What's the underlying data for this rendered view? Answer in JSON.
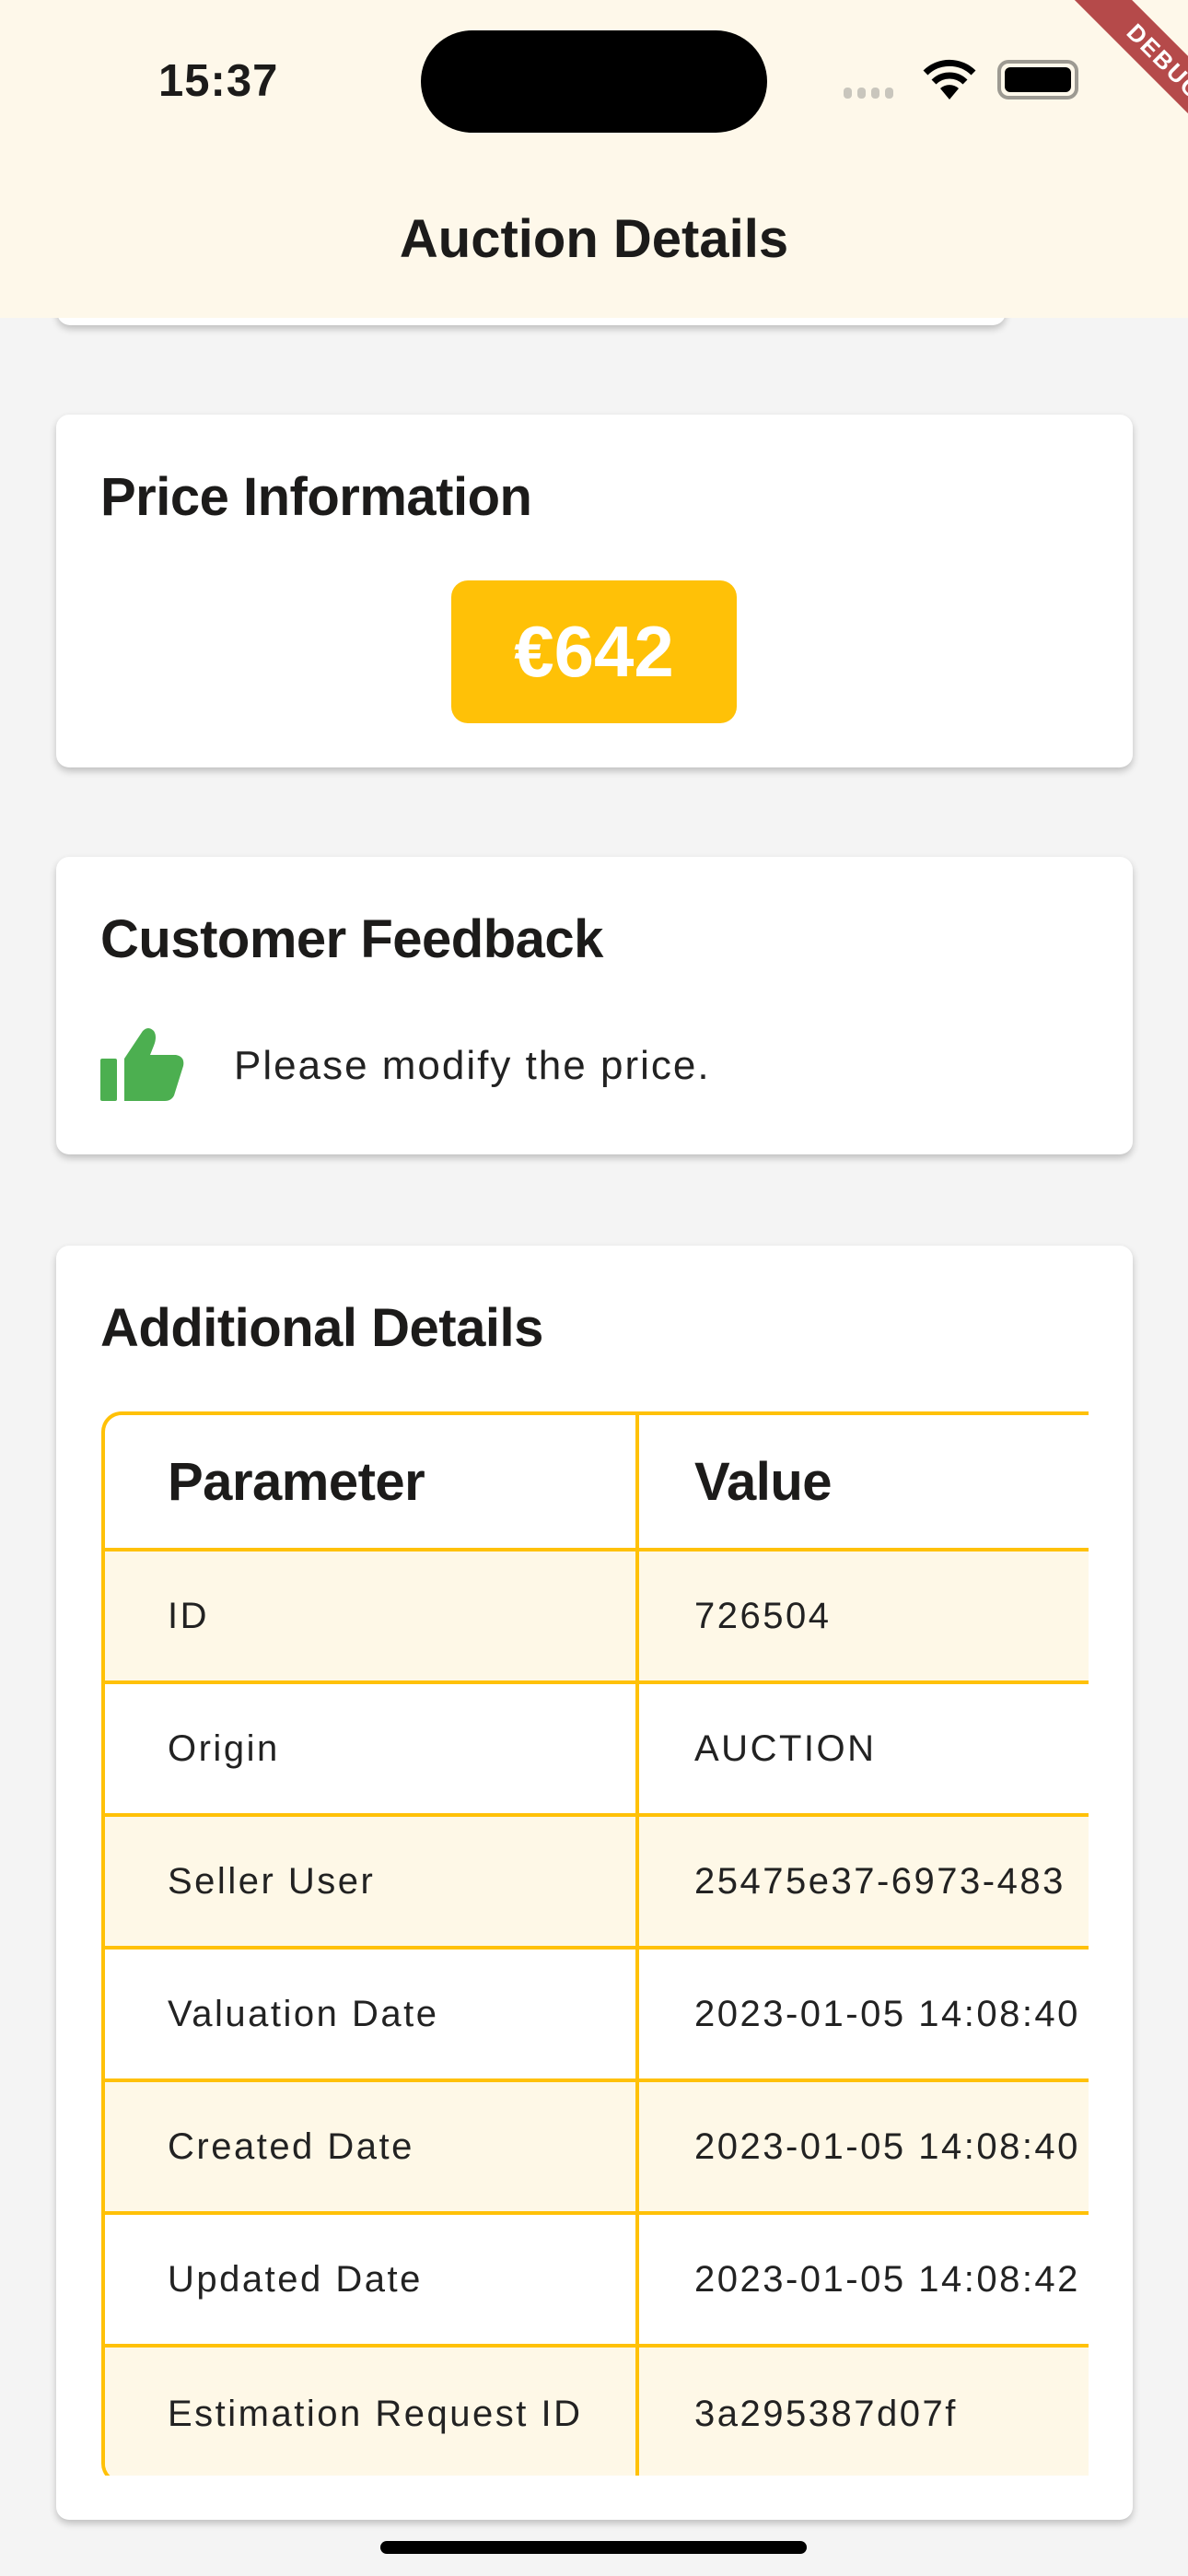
{
  "status_bar": {
    "time": "15:37",
    "debug_banner": "DEBUG"
  },
  "header": {
    "title": "Auction Details"
  },
  "price": {
    "title": "Price Information",
    "amount": "€642",
    "badge_color": "#FFC107"
  },
  "feedback": {
    "title": "Customer Feedback",
    "icon": "thumbs-up-icon",
    "icon_color": "#4CAF50",
    "text": "Please modify the price."
  },
  "details": {
    "title": "Additional Details",
    "columns": [
      "Parameter",
      "Value"
    ],
    "rows": [
      {
        "param": "ID",
        "value": "726504"
      },
      {
        "param": "Origin",
        "value": "AUCTION"
      },
      {
        "param": "Seller User",
        "value": "25475e37-6973-483"
      },
      {
        "param": "Valuation Date",
        "value": "2023-01-05 14:08:40"
      },
      {
        "param": "Created Date",
        "value": "2023-01-05 14:08:40"
      },
      {
        "param": "Updated Date",
        "value": "2023-01-05 14:08:42"
      },
      {
        "param": "Estimation Request ID",
        "value": "3a295387d07f"
      }
    ],
    "border_color": "#FFC107"
  }
}
